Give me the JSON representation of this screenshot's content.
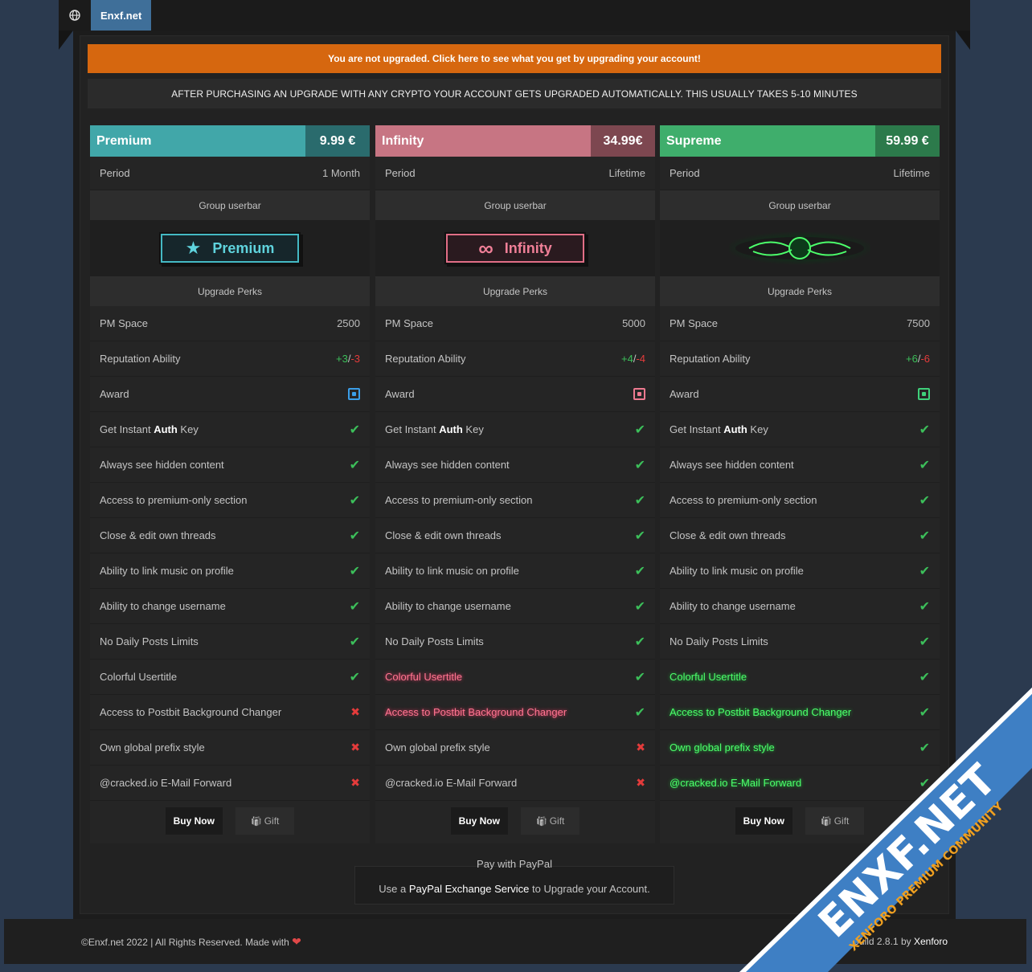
{
  "nav": {
    "site_tab": "Enxf.net"
  },
  "notices": {
    "upgrade": "You are not upgraded. Click here to see what you get by upgrading your account!",
    "crypto": "AFTER PURCHASING AN UPGRADE WITH ANY CRYPTO YOUR ACCOUNT GETS UPGRADED AUTOMATICALLY. THIS USUALLY TAKES 5-10 MINUTES"
  },
  "labels": {
    "period": "Period",
    "group_userbar": "Group userbar",
    "upgrade_perks": "Upgrade Perks",
    "pm_space": "PM Space",
    "reputation": "Reputation Ability",
    "award": "Award",
    "auth_pre": "Get Instant ",
    "auth_bold": "Auth",
    "auth_post": " Key",
    "hidden": "Always see hidden content",
    "premium_section": "Access to premium-only section",
    "close_edit": "Close & edit own threads",
    "music": "Ability to link music on profile",
    "username": "Ability to change username",
    "no_limits": "No Daily Posts Limits",
    "usertitle": "Colorful Usertitle",
    "postbit": "Access to Postbit Background Changer",
    "prefix": "Own global prefix style",
    "email": "@cracked.io E-Mail Forward",
    "buy": "Buy Now",
    "gift": "Gift"
  },
  "plans": [
    {
      "name": "Premium",
      "price": "9.99 €",
      "period": "1 Month",
      "userbar": "Premium",
      "pm_space": "2500",
      "rep_plus": "+3",
      "rep_minus": "-3",
      "head_color": "#41a7a9",
      "price_color": "#2a6b6d",
      "award_color": "#3b9ee8"
    },
    {
      "name": "Infinity",
      "price": "34.99€",
      "period": "Lifetime",
      "userbar": "Infinity",
      "pm_space": "5000",
      "rep_plus": "+4",
      "rep_minus": "-4",
      "head_color": "#c77583",
      "price_color": "#7d4750",
      "award_color": "#ee7a90"
    },
    {
      "name": "Supreme",
      "price": "59.99 €",
      "period": "Lifetime",
      "userbar": "",
      "pm_space": "7500",
      "rep_plus": "+6",
      "rep_minus": "-6",
      "head_color": "#3fae6c",
      "price_color": "#2c7a4b",
      "award_color": "#3fd07a"
    }
  ],
  "paypal": {
    "title": "Pay with PayPal",
    "pre": "Use a ",
    "link": "PayPal Exchange Service",
    "post": " to Upgrade your Account."
  },
  "footer": {
    "left": "©Enxf.net 2022 | All Rights Reserved. Made with",
    "right_pre": "Build 2.8.1 by ",
    "right_link": "Xenforo"
  },
  "watermark": {
    "main": "ENXF.NET",
    "sub": "XENFORO PREMIUM COMMUNITY"
  }
}
